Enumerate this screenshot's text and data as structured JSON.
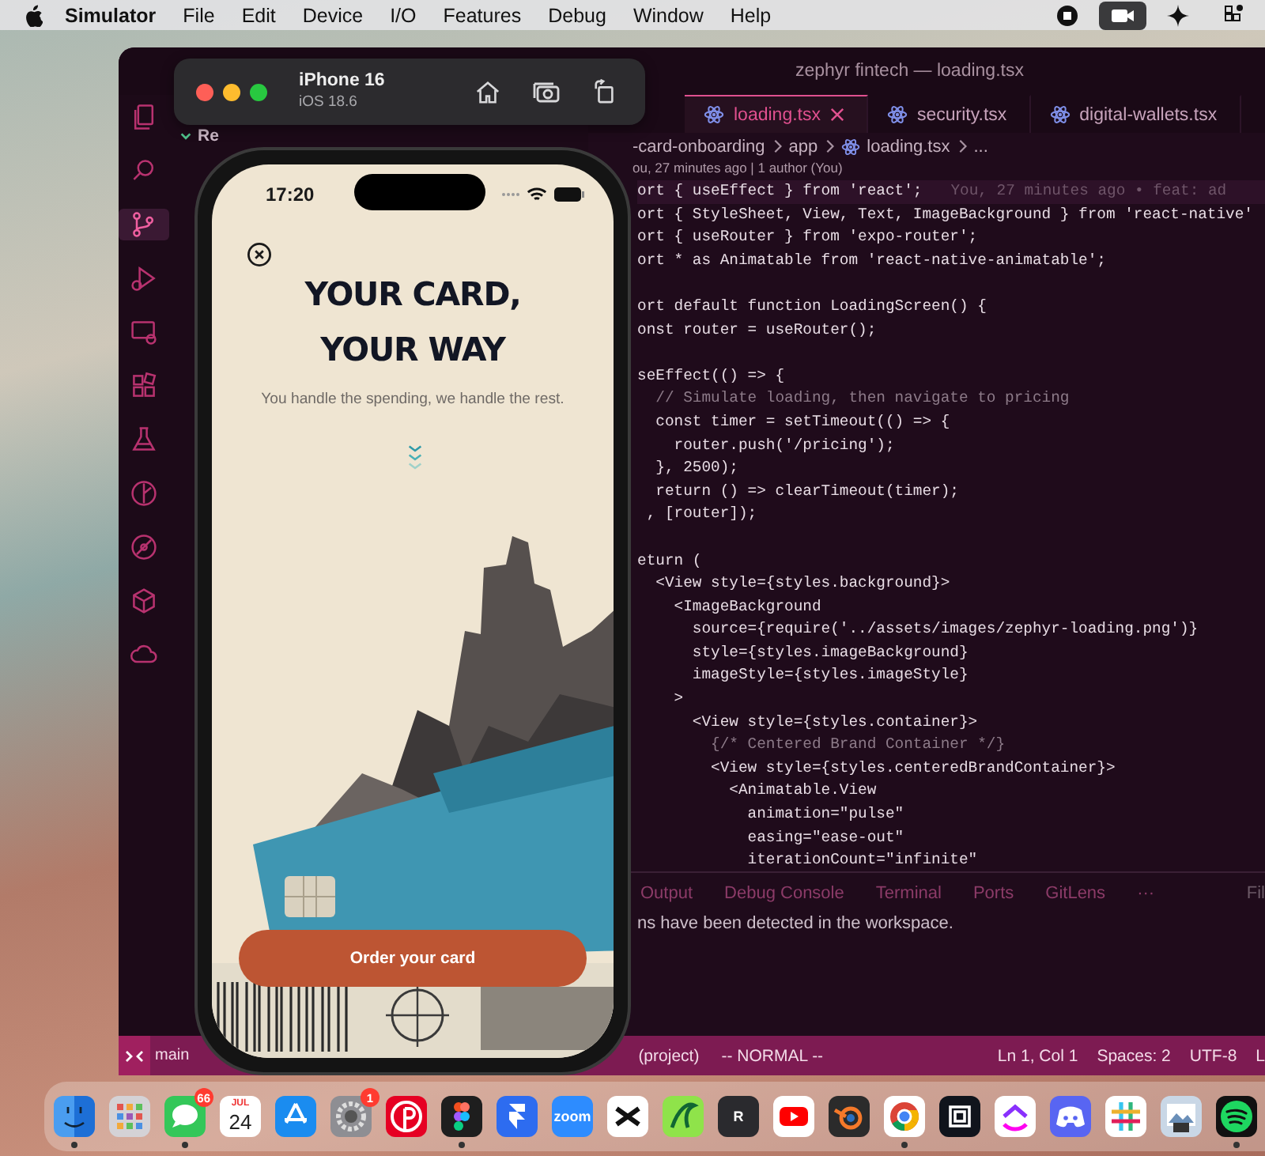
{
  "menubar": {
    "app": "Simulator",
    "menus": [
      "File",
      "Edit",
      "Device",
      "I/O",
      "Features",
      "Debug",
      "Window",
      "Help"
    ],
    "status_icons": [
      {
        "kind": "stop",
        "selected": false
      },
      {
        "kind": "camera",
        "selected": true
      },
      {
        "kind": "sparkle",
        "selected": false
      },
      {
        "kind": "grid",
        "selected": false
      }
    ]
  },
  "editor": {
    "title": "zephyr fintech — loading.tsx",
    "activity": [
      {
        "kind": "files",
        "selected": false
      },
      {
        "kind": "search",
        "selected": false
      },
      {
        "kind": "branch",
        "selected": true
      },
      {
        "kind": "run",
        "selected": false
      },
      {
        "kind": "monitor",
        "selected": false
      },
      {
        "kind": "blocks",
        "selected": false
      },
      {
        "kind": "flask",
        "selected": false
      },
      {
        "kind": "graph",
        "selected": false
      },
      {
        "kind": "gauge",
        "selected": false
      },
      {
        "kind": "cube",
        "selected": false
      },
      {
        "kind": "cloud",
        "selected": false
      }
    ],
    "sidebar": {
      "header": "Re"
    },
    "tabs": [
      {
        "label": "loading.tsx",
        "selected": true
      },
      {
        "label": "security.tsx",
        "selected": false
      },
      {
        "label": "digital-wallets.tsx",
        "selected": false
      }
    ],
    "breadcrumb": [
      "-card-onboarding",
      "app",
      "loading.tsx",
      "..."
    ],
    "blame": "ou, 27 minutes ago | 1 author (You)",
    "code": [
      {
        "kind": "code",
        "text": "ort { useEffect } from 'react';",
        "annotation": "You, 27 minutes ago • feat: ad"
      },
      {
        "kind": "code",
        "text": "ort { StyleSheet, View, Text, ImageBackground } from 'react-native'"
      },
      {
        "kind": "code",
        "text": "ort { useRouter } from 'expo-router';"
      },
      {
        "kind": "code",
        "text": "ort * as Animatable from 'react-native-animatable';"
      },
      {
        "kind": "blank"
      },
      {
        "kind": "code",
        "text": "ort default function LoadingScreen() {"
      },
      {
        "kind": "code",
        "text": "onst router = useRouter();"
      },
      {
        "kind": "blank"
      },
      {
        "kind": "code",
        "text": "seEffect(() => {"
      },
      {
        "kind": "comment",
        "text": "  // Simulate loading, then navigate to pricing"
      },
      {
        "kind": "code",
        "text": "  const timer = setTimeout(() => {"
      },
      {
        "kind": "code",
        "text": "    router.push('/pricing');"
      },
      {
        "kind": "code",
        "text": "  }, 2500);"
      },
      {
        "kind": "code",
        "text": "  return () => clearTimeout(timer);"
      },
      {
        "kind": "code",
        "text": " , [router]);"
      },
      {
        "kind": "blank"
      },
      {
        "kind": "code",
        "text": "eturn ("
      },
      {
        "kind": "code",
        "text": "  <View style={styles.background}>"
      },
      {
        "kind": "code",
        "text": "    <ImageBackground"
      },
      {
        "kind": "code",
        "text": "      source={require('../assets/images/zephyr-loading.png')}"
      },
      {
        "kind": "code",
        "text": "      style={styles.imageBackground}"
      },
      {
        "kind": "code",
        "text": "      imageStyle={styles.imageStyle}"
      },
      {
        "kind": "code",
        "text": "    >"
      },
      {
        "kind": "code",
        "text": "      <View style={styles.container}>"
      },
      {
        "kind": "comment",
        "text": "        {/* Centered Brand Container */}"
      },
      {
        "kind": "code",
        "text": "        <View style={styles.centeredBrandContainer}>"
      },
      {
        "kind": "code",
        "text": "          <Animatable.View"
      },
      {
        "kind": "code",
        "text": "            animation=\"pulse\""
      },
      {
        "kind": "code",
        "text": "            easing=\"ease-out\""
      },
      {
        "kind": "code",
        "text": "            iterationCount=\"infinite\""
      }
    ],
    "panel": {
      "tabs": [
        "Output",
        "Debug Console",
        "Terminal",
        "Ports",
        "GitLens"
      ],
      "more": "···",
      "filter": "Fil",
      "message": "ns have been detected in the workspace."
    },
    "status_bar": {
      "branch": "main",
      "left": [
        "(project)",
        "-- NORMAL --"
      ],
      "right": [
        "Ln 1, Col 1",
        "Spaces: 2",
        "UTF-8",
        "L"
      ]
    }
  },
  "simulator": {
    "device": "iPhone 16",
    "os": "iOS 18.6"
  },
  "phone": {
    "time": "17:20",
    "title_lines": [
      "YOUR CARD,",
      "YOUR WAY"
    ],
    "subtitle": "You handle the spending, we handle the rest.",
    "button": "Order your card"
  },
  "dock": [
    {
      "kind": "finder",
      "color": "#4a9df0",
      "running": true
    },
    {
      "kind": "launchpad",
      "color": "#d4d2d6",
      "running": false
    },
    {
      "kind": "messages",
      "color": "#34c759",
      "running": true,
      "badge": "66"
    },
    {
      "kind": "calendar",
      "color": "#ffffff",
      "running": false,
      "month": "JUL",
      "day": "24"
    },
    {
      "kind": "appstore",
      "color": "#1a8cf0",
      "running": false
    },
    {
      "kind": "settings",
      "color": "#8e8e93",
      "running": false,
      "badge": "1"
    },
    {
      "kind": "pinterest",
      "color": "#e60023",
      "running": false
    },
    {
      "kind": "figma",
      "color": "#1e1e1e",
      "running": true
    },
    {
      "kind": "framer",
      "color": "#2d6cf0",
      "running": false
    },
    {
      "kind": "text",
      "color": "#2d8cff",
      "running": false,
      "label": "zoom"
    },
    {
      "kind": "capcut",
      "color": "#ffffff",
      "running": false
    },
    {
      "kind": "swoosh",
      "color": "#8fe34a",
      "running": false
    },
    {
      "kind": "text",
      "color": "#2a2a2e",
      "running": false,
      "label": "R"
    },
    {
      "kind": "youtube",
      "color": "#ffffff",
      "running": false
    },
    {
      "kind": "blender",
      "color": "#2b2b2b",
      "running": false
    },
    {
      "kind": "chrome",
      "color": "#ffffff",
      "running": true
    },
    {
      "kind": "cubelogo",
      "color": "#10141c",
      "running": false
    },
    {
      "kind": "clickup",
      "color": "#ffffff",
      "running": false
    },
    {
      "kind": "discord",
      "color": "#5865f2",
      "running": false
    },
    {
      "kind": "slack",
      "color": "#ffffff",
      "running": false
    },
    {
      "kind": "preview",
      "color": "#c9d7e6",
      "running": false
    },
    {
      "kind": "spotify",
      "color": "#111111",
      "running": true
    }
  ]
}
